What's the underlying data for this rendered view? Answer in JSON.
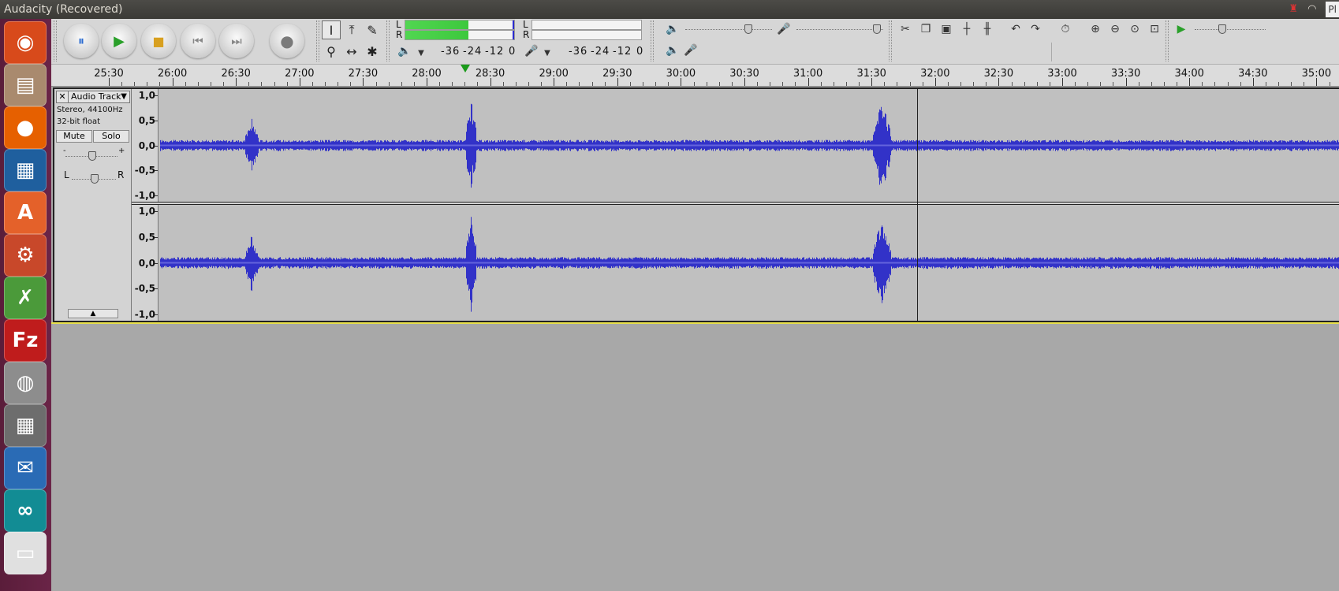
{
  "window": {
    "title": "Audacity (Recovered)"
  },
  "tray": {
    "right_label": "Pl"
  },
  "launcher": {
    "items": [
      {
        "name": "ubuntu-dash-icon",
        "glyph": "◉",
        "bg": "#d84a1b"
      },
      {
        "name": "files-icon",
        "glyph": "▤",
        "bg": "#a98a6e"
      },
      {
        "name": "firefox-icon",
        "glyph": "●",
        "bg": "#e66000"
      },
      {
        "name": "libreoffice-writer-icon",
        "glyph": "▦",
        "bg": "#1f5f9e"
      },
      {
        "name": "software-center-icon",
        "glyph": "A",
        "bg": "#e4612a"
      },
      {
        "name": "system-settings-icon",
        "glyph": "⚙",
        "bg": "#c8482a"
      },
      {
        "name": "xournal-icon",
        "glyph": "✗",
        "bg": "#4b9a3a"
      },
      {
        "name": "filezilla-icon",
        "glyph": "Fz",
        "bg": "#bf1c1c"
      },
      {
        "name": "disk-icon",
        "glyph": "◍",
        "bg": "#8d8d8d"
      },
      {
        "name": "calculator-icon",
        "glyph": "▦",
        "bg": "#6d6d6d"
      },
      {
        "name": "thunderbird-icon",
        "glyph": "✉",
        "bg": "#2a6bb5"
      },
      {
        "name": "arduino-icon",
        "glyph": "∞",
        "bg": "#128c94"
      },
      {
        "name": "more-app-icon",
        "glyph": "▭",
        "bg": "#e0e0e0"
      }
    ]
  },
  "transport": {
    "pause_icon": "⏸",
    "play_icon": "▶",
    "stop_icon": "■",
    "skip_start_icon": "⏮",
    "skip_end_icon": "⏭",
    "record_icon": "●"
  },
  "tools": {
    "selection": "I",
    "envelope": "⤒",
    "draw": "✎",
    "zoom": "⚲",
    "timeshift": "↔",
    "multi": "✱"
  },
  "meters": {
    "playback": {
      "l_label": "L",
      "r_label": "R",
      "l_level": 0.58,
      "r_level": 0.58,
      "scale": [
        "-36",
        "-24",
        "-12",
        "0"
      ]
    },
    "record": {
      "l_label": "L",
      "r_label": "R",
      "l_level": 0.0,
      "r_level": 0.0,
      "scale": [
        "-36",
        "-24",
        "-12",
        "0"
      ]
    }
  },
  "mixer": {
    "playback_volume": 0.8,
    "recording_volume": 0.97
  },
  "playspeed": {
    "level": 0.38
  },
  "ruler": {
    "labels": [
      "25:30",
      "26:00",
      "26:30",
      "27:00",
      "27:30",
      "28:00",
      "28:30",
      "29:00",
      "29:30",
      "30:00",
      "30:30",
      "31:00",
      "31:30",
      "32:00",
      "32:30",
      "33:00",
      "33:30",
      "34:00",
      "34:30",
      "35:00"
    ]
  },
  "track": {
    "name": "Audio Track",
    "format": "Stereo, 44100Hz",
    "bitdepth": "32-bit float",
    "mute_label": "Mute",
    "solo_label": "Solo",
    "gain_minus": "-",
    "gain_plus": "+",
    "pan_left": "L",
    "pan_right": "R",
    "channel_axis": [
      "1,0",
      "0,5",
      "0,0",
      "-0,5",
      "-1,0"
    ]
  },
  "colors": {
    "wave": "#3232c8",
    "wave_light": "#6464dc",
    "accent": "#e8e04a"
  }
}
